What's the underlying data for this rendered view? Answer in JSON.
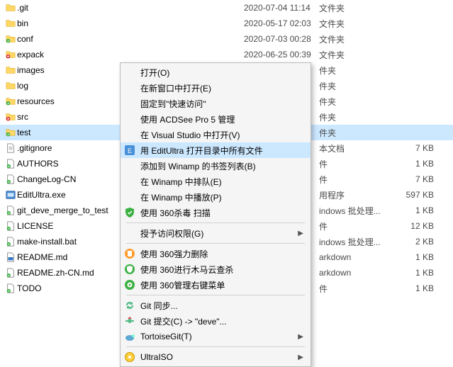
{
  "files": [
    {
      "name": ".git",
      "date": "2020-07-04 11:14",
      "type": "文件夹",
      "size": "",
      "icon": "folder-yellow"
    },
    {
      "name": "bin",
      "date": "2020-05-17 02:03",
      "type": "文件夹",
      "size": "",
      "icon": "folder-yellow"
    },
    {
      "name": "conf",
      "date": "2020-07-03 00:28",
      "type": "文件夹",
      "size": "",
      "icon": "folder-green"
    },
    {
      "name": "expack",
      "date": "2020-06-25 00:39",
      "type": "文件夹",
      "size": "",
      "icon": "folder-red"
    },
    {
      "name": "images",
      "date": "",
      "type": "件夹",
      "size": "",
      "icon": "folder-yellow"
    },
    {
      "name": "log",
      "date": "",
      "type": "件夹",
      "size": "",
      "icon": "folder-yellow"
    },
    {
      "name": "resources",
      "date": "",
      "type": "件夹",
      "size": "",
      "icon": "folder-green"
    },
    {
      "name": "src",
      "date": "",
      "type": "件夹",
      "size": "",
      "icon": "folder-red"
    },
    {
      "name": "test",
      "date": "",
      "type": "件夹",
      "size": "",
      "icon": "folder-green",
      "selected": true
    },
    {
      "name": ".gitignore",
      "date": "",
      "type": "本文档",
      "size": "7 KB",
      "icon": "file-text"
    },
    {
      "name": "AUTHORS",
      "date": "",
      "type": "件",
      "size": "1 KB",
      "icon": "file-green"
    },
    {
      "name": "ChangeLog-CN",
      "date": "",
      "type": "件",
      "size": "7 KB",
      "icon": "file-green"
    },
    {
      "name": "EditUltra.exe",
      "date": "",
      "type": "用程序",
      "size": "597 KB",
      "icon": "exe"
    },
    {
      "name": "git_deve_merge_to_test",
      "date": "",
      "type": "indows 批处理...",
      "size": "1 KB",
      "icon": "file-green"
    },
    {
      "name": "LICENSE",
      "date": "",
      "type": "件",
      "size": "12 KB",
      "icon": "file-green"
    },
    {
      "name": "make-install.bat",
      "date": "",
      "type": "indows 批处理...",
      "size": "2 KB",
      "icon": "file-green"
    },
    {
      "name": "README.md",
      "date": "",
      "type": "arkdown",
      "size": "1 KB",
      "icon": "md"
    },
    {
      "name": "README.zh-CN.md",
      "date": "",
      "type": "arkdown",
      "size": "1 KB",
      "icon": "file-green"
    },
    {
      "name": "TODO",
      "date": "",
      "type": "件",
      "size": "1 KB",
      "icon": "file-green"
    }
  ],
  "context_menu": {
    "items": [
      {
        "label": "打开(O)",
        "icon": ""
      },
      {
        "label": "在新窗口中打开(E)",
        "icon": ""
      },
      {
        "label": "固定到\"快速访问\"",
        "icon": ""
      },
      {
        "label": "使用 ACDSee Pro 5 管理",
        "icon": ""
      },
      {
        "label": "在 Visual Studio 中打开(V)",
        "icon": ""
      },
      {
        "label": "用 EditUltra 打开目录中所有文件",
        "icon": "editultra",
        "highlight": true
      },
      {
        "label": "添加到 Winamp 的书签列表(B)",
        "icon": ""
      },
      {
        "label": "在 Winamp 中排队(E)",
        "icon": ""
      },
      {
        "label": "在 Winamp 中播放(P)",
        "icon": ""
      },
      {
        "label": "使用 360杀毒 扫描",
        "icon": "shield-green"
      },
      {
        "sep": true
      },
      {
        "label": "授予访问权限(G)",
        "icon": "",
        "arrow": true
      },
      {
        "sep": true
      },
      {
        "label": "使用 360强力删除",
        "icon": "trash-orange"
      },
      {
        "label": "使用 360进行木马云查杀",
        "icon": "shield-360"
      },
      {
        "label": "使用 360管理右键菜单",
        "icon": "gear-360"
      },
      {
        "sep": true
      },
      {
        "label": "Git 同步...",
        "icon": "git-sync"
      },
      {
        "label": "Git 提交(C) -> \"deve\"...",
        "icon": "git-commit"
      },
      {
        "label": "TortoiseGit(T)",
        "icon": "tortoise",
        "arrow": true
      },
      {
        "sep": true
      },
      {
        "label": "UltraISO",
        "icon": "ultraiso",
        "arrow": true
      }
    ]
  }
}
